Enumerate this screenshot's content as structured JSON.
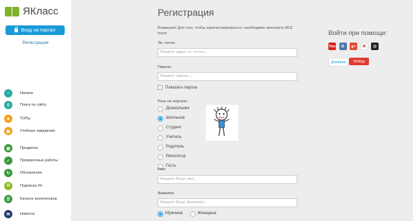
{
  "brand": {
    "name": "ЯКласс",
    "color": "#7fb32b"
  },
  "sidebar": {
    "login_button": "Вход на портал",
    "register_link": "Регистрация",
    "items": [
      {
        "label": "Начало",
        "icon": "home-icon",
        "color": "#27a9a0",
        "glyph": "⌂"
      },
      {
        "label": "Поиск по сайту",
        "icon": "search-icon",
        "color": "#27a9a0",
        "glyph": "⚲"
      },
      {
        "label": "ТОПы",
        "icon": "trophy-icon",
        "color": "#f2a01f",
        "glyph": "★"
      },
      {
        "label": "Учебные заведения",
        "icon": "school-icon",
        "color": "#f2a01f",
        "glyph": "▣"
      },
      {
        "label": "Предметы",
        "icon": "book-icon",
        "color": "#3a9a3a",
        "glyph": "▤"
      },
      {
        "label": "Проверочные работы",
        "icon": "check-icon",
        "color": "#3a9a3a",
        "glyph": "✓"
      },
      {
        "label": "Обновления",
        "icon": "updates-icon",
        "color": "#3a9a3a",
        "glyph": "↻"
      },
      {
        "label": "Подписка Я+",
        "icon": "subscription-icon",
        "color": "#8fba2a",
        "glyph": "Я"
      },
      {
        "label": "Каталог репетиторов",
        "icon": "tutors-icon",
        "color": "#3a9a3a",
        "glyph": "☰"
      },
      {
        "label": "Новости",
        "icon": "news-icon",
        "color": "#1f3d6b",
        "glyph": "✉"
      }
    ]
  },
  "form": {
    "title": "Регистрация",
    "notice": "Внимание! Для того, чтобы зарегистрироваться, необходимо заполнить ВСЕ поля!",
    "email_label": "Эл. почта:",
    "email_placeholder": "Введите адрес эл. почты...",
    "password_label": "Пароль:",
    "password_placeholder": "Введите пароль...",
    "show_password": "Показать пароль",
    "role_label": "Роль на портале:",
    "roles": [
      {
        "label": "Дошкольник",
        "selected": false
      },
      {
        "label": "Школьник",
        "selected": true
      },
      {
        "label": "Студент",
        "selected": false
      },
      {
        "label": "Учитель",
        "selected": false
      },
      {
        "label": "Родитель",
        "selected": false
      },
      {
        "label": "Репетитор",
        "selected": false
      },
      {
        "label": "Гость",
        "selected": false
      }
    ],
    "name_label": "Имя:",
    "name_placeholder": "Введите Ваше имя...",
    "surname_label": "Фамилия:",
    "surname_placeholder": "Введите Вашу фамилию...",
    "genders": [
      {
        "label": "Мужчина",
        "selected": true
      },
      {
        "label": "Женщина",
        "selected": false
      }
    ]
  },
  "social": {
    "title": "Войти при помощи:",
    "icons": [
      {
        "name": "youtube-icon",
        "text": "You",
        "color": "#d8221d"
      },
      {
        "name": "vk-icon",
        "text": "B",
        "color": "#4c75a3"
      },
      {
        "name": "google-plus-icon",
        "text": "g+",
        "color": "#dd4b39"
      },
      {
        "name": "yandex-icon",
        "text": "Я",
        "color": "#ffffff"
      },
      {
        "name": "mail-ru-icon",
        "text": "@",
        "color": "#222222"
      }
    ],
    "dnevnik": "Дневник",
    "elzhur": "ЭлЖур"
  }
}
